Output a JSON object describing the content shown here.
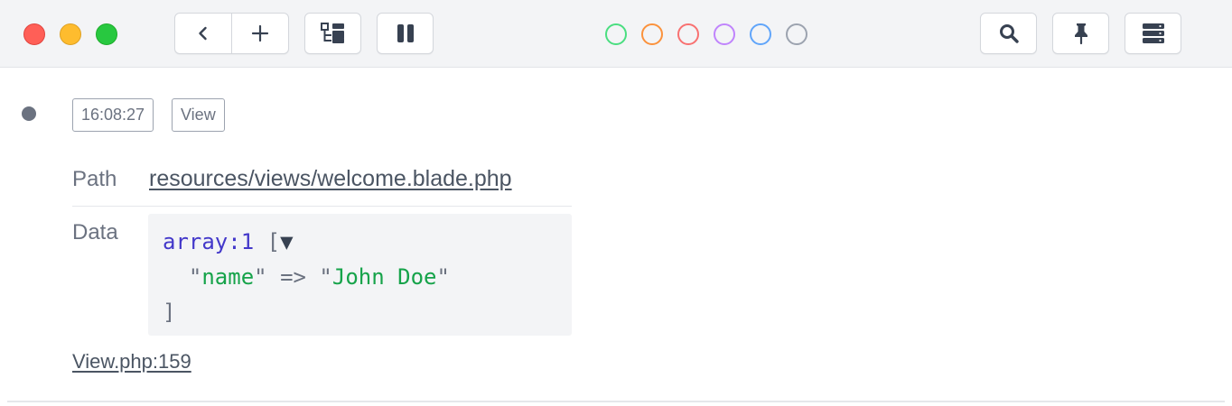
{
  "toolbar": {
    "traffic_lights": {
      "close": "#ff5f57",
      "minimize": "#febc2e",
      "zoom": "#28c840"
    },
    "buttons": {
      "back_icon": "chevron-left-icon",
      "new_icon": "plus-icon",
      "tree_icon": "tree-view-icon",
      "pause_icon": "pause-icon",
      "search_icon": "search-icon",
      "pin_icon": "pin-icon",
      "server_icon": "server-stack-icon"
    },
    "color_filters": [
      {
        "name": "green",
        "color": "#4ade80"
      },
      {
        "name": "orange",
        "color": "#fb923c"
      },
      {
        "name": "red",
        "color": "#f87171"
      },
      {
        "name": "purple",
        "color": "#c084fc"
      },
      {
        "name": "blue",
        "color": "#60a5fa"
      },
      {
        "name": "gray",
        "color": "#9ca3af"
      }
    ]
  },
  "entry": {
    "time": "16:08:27",
    "type": "View",
    "path_label": "Path",
    "path_value": "resources/views/welcome.blade.php",
    "data_label": "Data",
    "data": {
      "type": "array",
      "count_sep": ":",
      "count": "1",
      "open_bracket": "[",
      "toggle": "▼",
      "key": "name",
      "arrow": "=>",
      "value": "John Doe",
      "close_bracket": "]"
    },
    "source": "View.php:159"
  }
}
